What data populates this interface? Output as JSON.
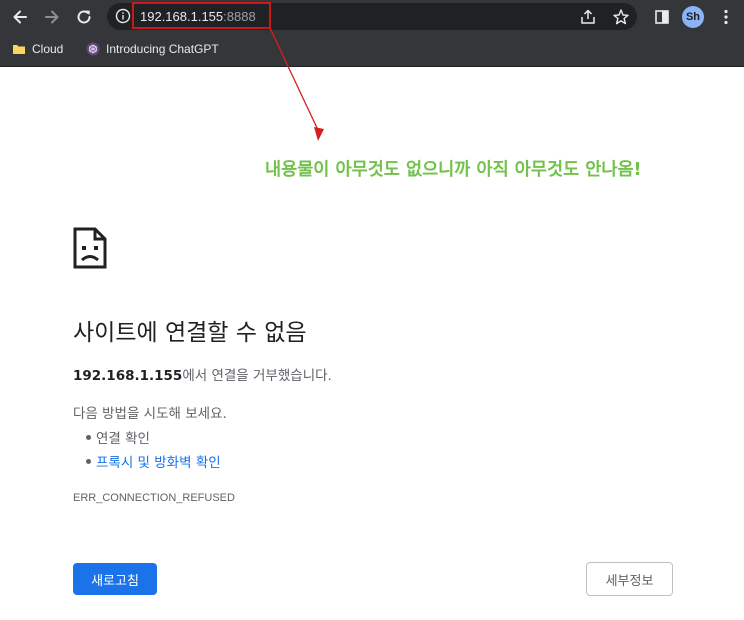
{
  "browser": {
    "url_host": "192.168.1.155",
    "url_port": ":8888",
    "profile_initials": "Sh",
    "bookmarks": [
      {
        "label": "Cloud",
        "icon": "folder-icon"
      },
      {
        "label": "Introducing ChatGPT",
        "icon": "openai-icon"
      }
    ]
  },
  "annotation": {
    "text": "내용물이 아무것도 없으니까 아직 아무것도 안나옴!",
    "color": "#72c14a",
    "highlight_color": "#c91a1a"
  },
  "error_page": {
    "title": "사이트에 연결할 수 없음",
    "host": "192.168.1.155",
    "description_suffix": "에서 연결을 거부했습니다.",
    "try_label": "다음 방법을 시도해 보세요.",
    "suggestions": [
      "연결 확인",
      "프록시 및 방화벽 확인"
    ],
    "error_code": "ERR_CONNECTION_REFUSED",
    "reload_label": "새로고침",
    "details_label": "세부정보"
  },
  "colors": {
    "accent": "#1a73e8",
    "chrome_bg": "#35363a",
    "omnibox_bg": "#202124"
  }
}
